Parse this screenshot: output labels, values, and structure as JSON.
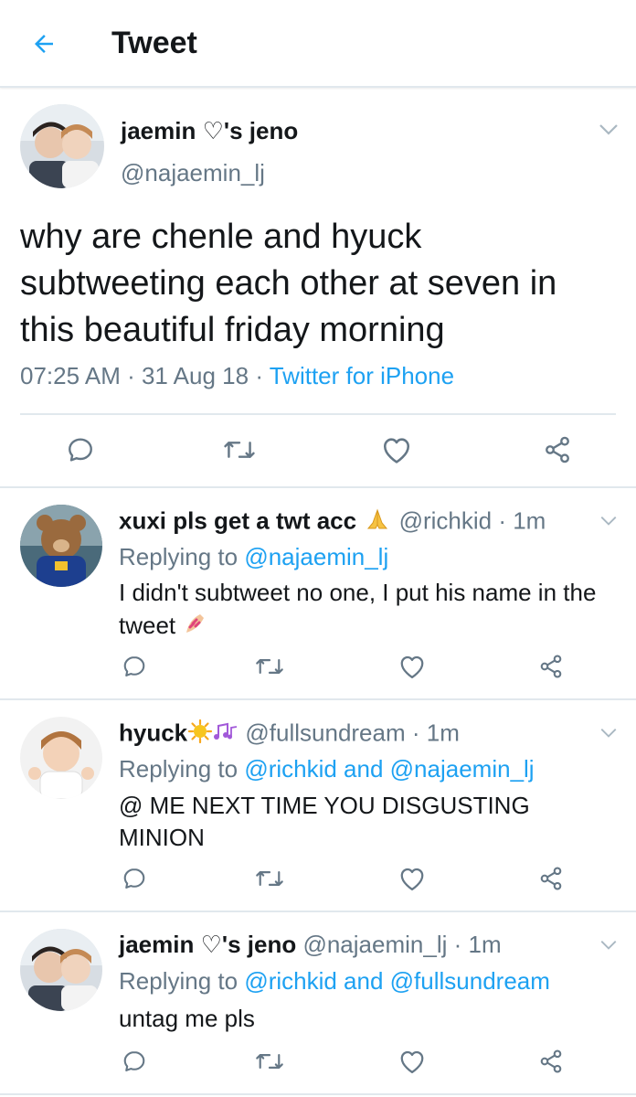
{
  "header": {
    "title": "Tweet"
  },
  "main_tweet": {
    "display_name": "jaemin ♡'s jeno",
    "handle": "@najaemin_lj",
    "text": "why are chenle and hyuck subtweeting each other at seven in this beautiful friday morning",
    "time": "07:25 AM",
    "date": "31 Aug 18",
    "source": "Twitter for iPhone",
    "sep": " · "
  },
  "replies": [
    {
      "display_name": "xuxi pls get a twt acc",
      "emoji": "🙏",
      "handle": "@richkid",
      "age": "1m",
      "replying_label": "Replying to",
      "replying_to": "@najaemin_lj",
      "text": "I didn't subtweet no one, I put his name in the tweet",
      "text_emoji": "💅"
    },
    {
      "display_name": "hyuck",
      "emoji": "☀️🎶",
      "handle": "@fullsundream",
      "age": "1m",
      "replying_label": "Replying to",
      "replying_to": "@richkid and @najaemin_lj",
      "text": "@ ME NEXT TIME YOU DISGUSTING MINION"
    },
    {
      "display_name": "jaemin ♡'s jeno",
      "handle": "@najaemin_lj",
      "age": "1m",
      "replying_label": "Replying to",
      "replying_to": "@richkid and @fullsundream",
      "text": "untag me pls"
    }
  ],
  "colors": {
    "accent": "#1da1f2",
    "muted": "#657786",
    "divider": "#e1e8ed",
    "text": "#14171a"
  },
  "icons": [
    "back-arrow-icon",
    "chevron-down-icon",
    "reply-icon",
    "retweet-icon",
    "like-icon",
    "share-icon"
  ]
}
